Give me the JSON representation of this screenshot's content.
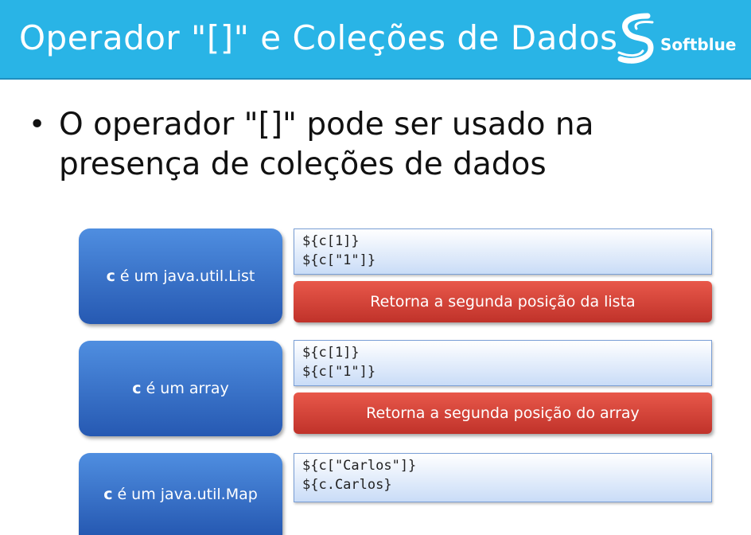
{
  "header": {
    "title": "Operador \"[]\" e Coleções de Dados",
    "logo_text": "Softblue"
  },
  "bullet": {
    "symbol": "•",
    "text": "O operador \"[]\" pode ser usado na presença de coleções de dados"
  },
  "rows": [
    {
      "var": "c",
      "desc": "é um java.util.List",
      "code": [
        "${c[1]}",
        "${c[\"1\"]}"
      ],
      "result": "Retorna a segunda posição da lista"
    },
    {
      "var": "c",
      "desc": "é um array",
      "code": [
        "${c[1]}",
        "${c[\"1\"]}"
      ],
      "result": "Retorna a segunda posição do array"
    },
    {
      "var": "c",
      "desc": "é um java.util.Map",
      "code": [
        "${c[\"Carlos\"]}",
        "${c.Carlos}"
      ]
    }
  ],
  "colors": {
    "header_bg": "#29b4e6",
    "blue_box": "#2f6bc4",
    "red_bar": "#d2443a",
    "code_bg": "#c9dcf7"
  }
}
